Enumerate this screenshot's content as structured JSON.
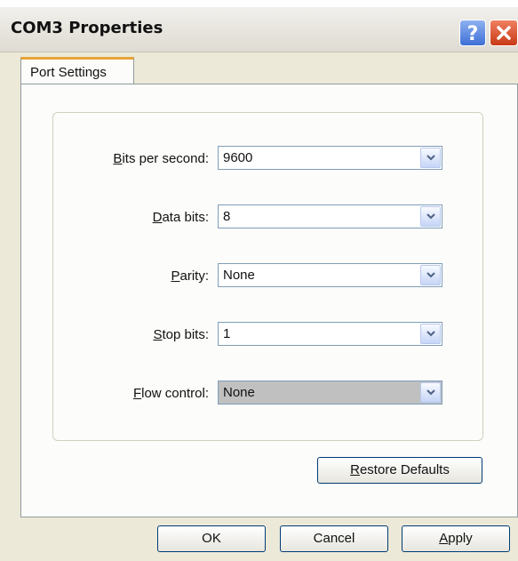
{
  "window": {
    "title": "COM3 Properties",
    "help_icon": "question-mark-icon",
    "close_icon": "close-x-icon"
  },
  "tabs": [
    {
      "label": "Port Settings",
      "selected": true
    }
  ],
  "settings": [
    {
      "label_mnemonic": "B",
      "label_rest": "its per second:",
      "value": "9600",
      "enabled": true
    },
    {
      "label_mnemonic": "D",
      "label_rest": "ata bits:",
      "value": "8",
      "enabled": true
    },
    {
      "label_mnemonic": "P",
      "label_rest": "arity:",
      "value": "None",
      "enabled": true
    },
    {
      "label_mnemonic": "S",
      "label_rest": "top bits:",
      "value": "1",
      "enabled": true
    },
    {
      "label_mnemonic": "F",
      "label_rest": "low control:",
      "value": "None",
      "enabled": false
    }
  ],
  "restore_button": {
    "mnemonic": "R",
    "rest": "estore Defaults"
  },
  "footer": {
    "ok_label": "OK",
    "cancel_label": "Cancel",
    "apply_mnemonic": "A",
    "apply_rest": "pply"
  },
  "colors": {
    "window_bg": "#ece9d8",
    "tab_accent": "#e8a338",
    "button_border": "#003c74",
    "close_red": "#c83a18",
    "help_blue": "#3d6fd6"
  }
}
